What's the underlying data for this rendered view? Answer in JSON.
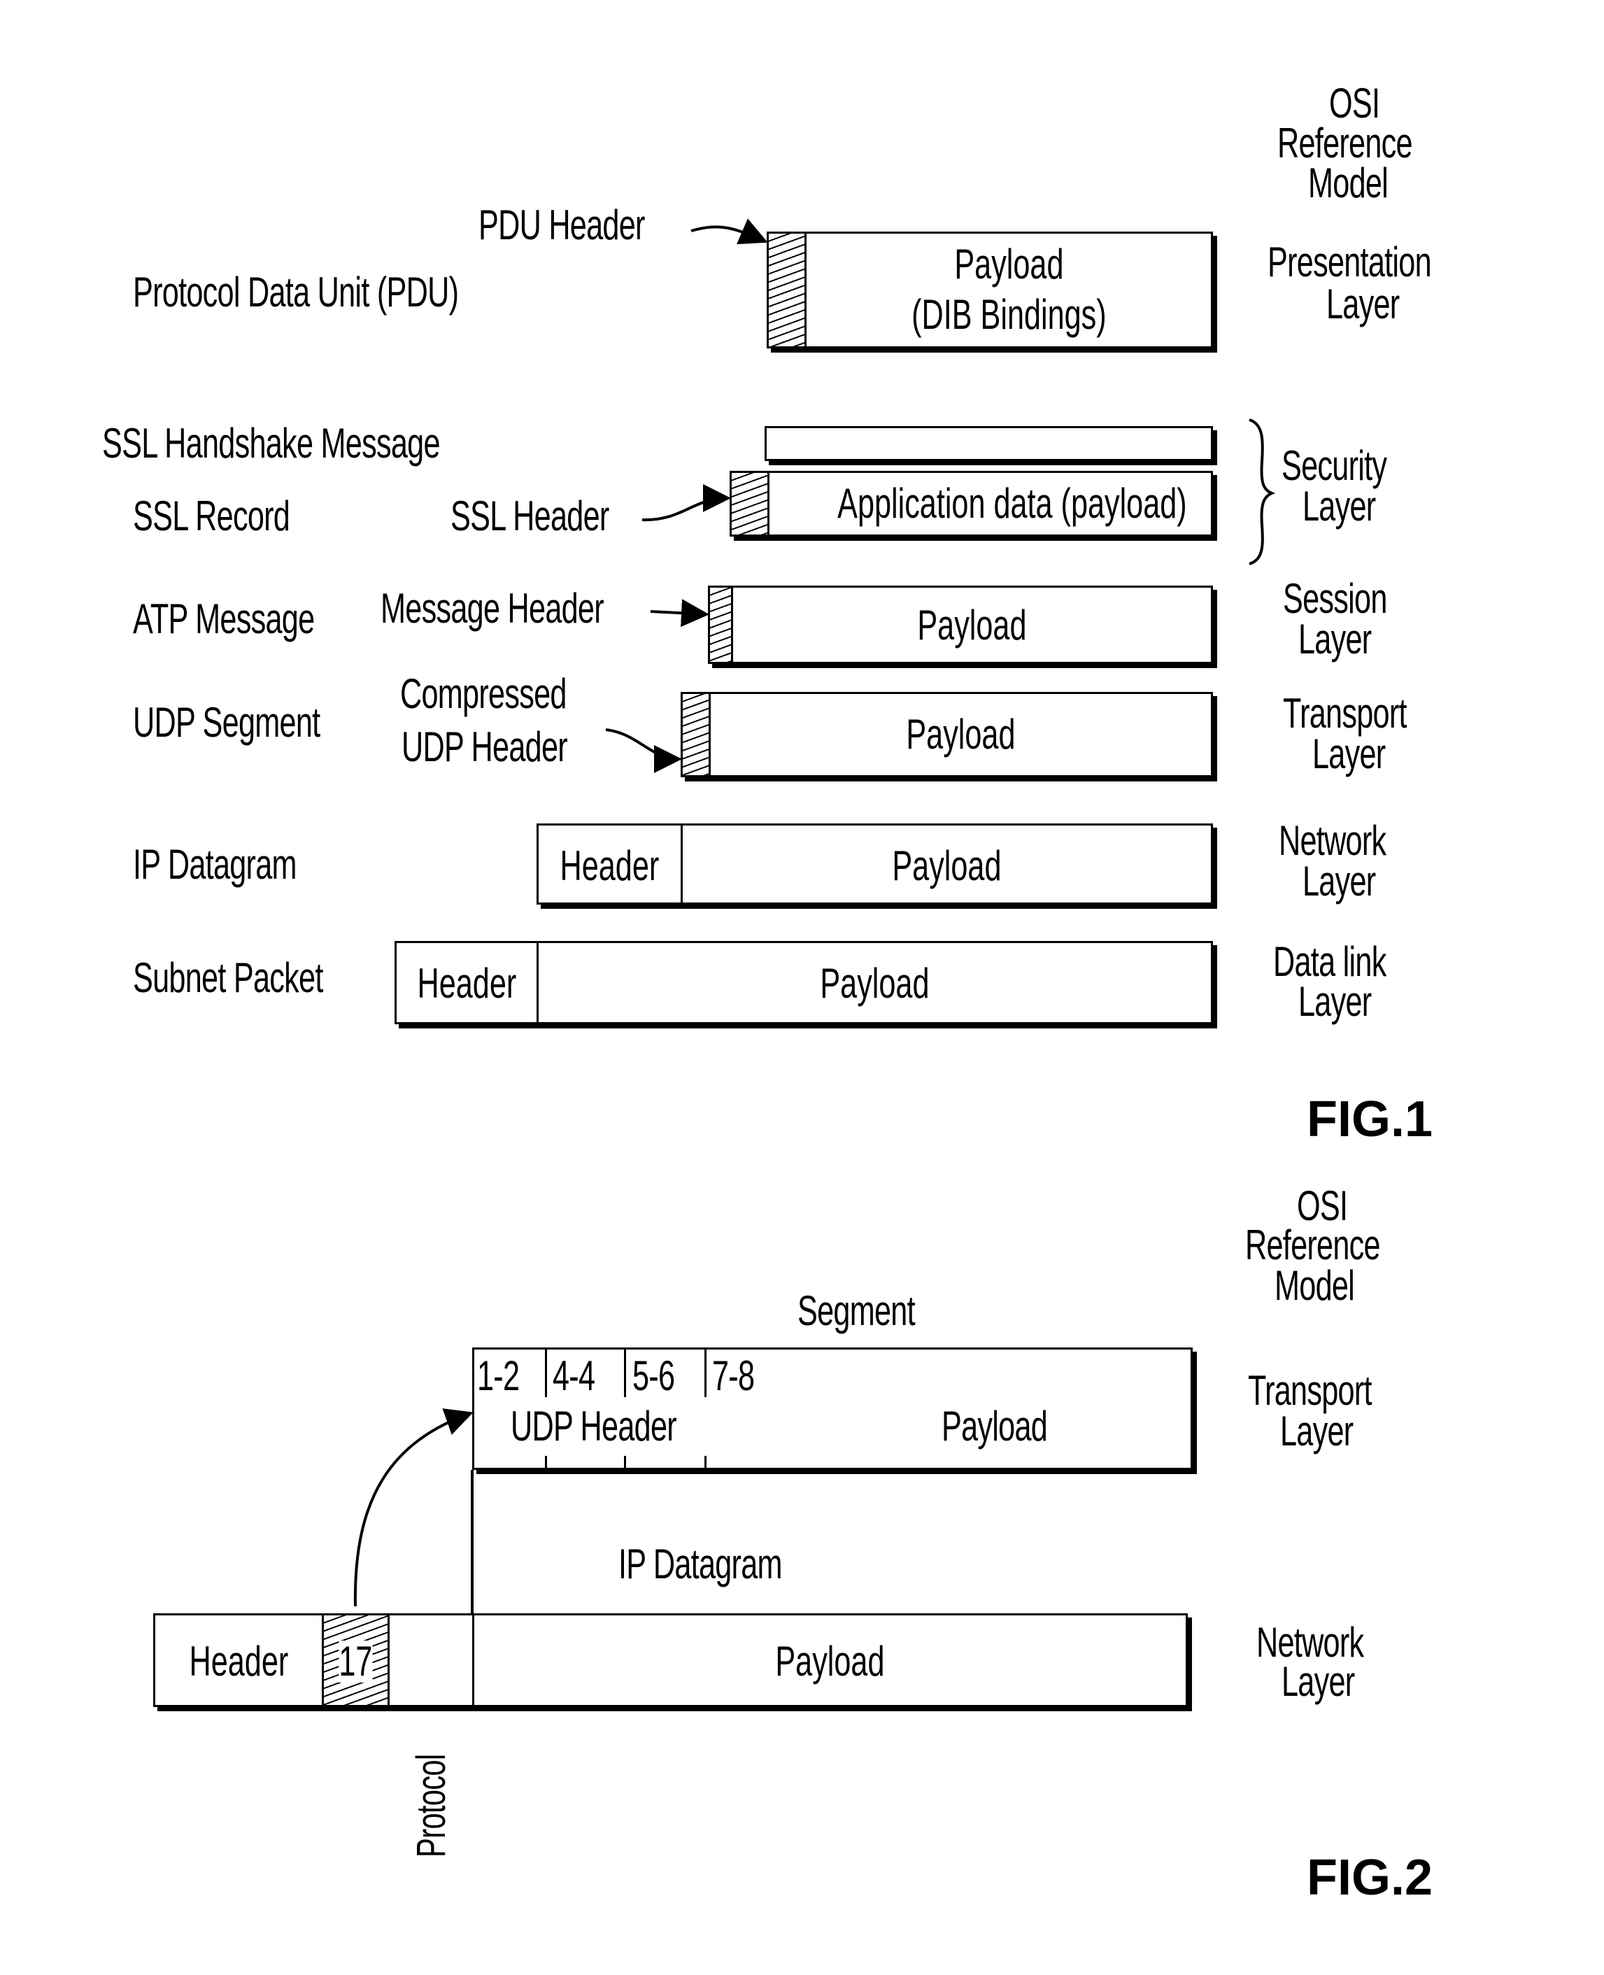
{
  "fig1": {
    "title": "FIG.1",
    "osi_header": [
      "OSI",
      "Reference",
      "Model"
    ],
    "rows": [
      {
        "id": "pdu",
        "name": "Protocol Data Unit (PDU)",
        "header_callout": "PDU Header",
        "payload": [
          "Payload",
          "(DIB Bindings)"
        ],
        "layer": [
          "Presentation",
          "Layer"
        ]
      },
      {
        "id": "ssl-handshake",
        "name": "SSL Handshake Message"
      },
      {
        "id": "ssl-record",
        "name": "SSL Record",
        "header_callout": "SSL Header",
        "payload": [
          "Application data (payload)"
        ],
        "layer": [
          "Security",
          "Layer"
        ]
      },
      {
        "id": "atp",
        "name": "ATP Message",
        "header_callout": "Message Header",
        "payload": [
          "Payload"
        ],
        "layer": [
          "Session",
          "Layer"
        ]
      },
      {
        "id": "udp",
        "name": "UDP Segment",
        "header_callout": [
          "Compressed",
          "UDP Header"
        ],
        "payload": [
          "Payload"
        ],
        "layer": [
          "Transport",
          "Layer"
        ]
      },
      {
        "id": "ip",
        "name": "IP Datagram",
        "header": "Header",
        "payload": [
          "Payload"
        ],
        "layer": [
          "Network",
          "Layer"
        ]
      },
      {
        "id": "subnet",
        "name": "Subnet Packet",
        "header": "Header",
        "payload": [
          "Payload"
        ],
        "layer": [
          "Data link",
          "Layer"
        ]
      }
    ]
  },
  "fig2": {
    "title": "FIG.2",
    "osi_header": [
      "OSI",
      "Reference",
      "Model"
    ],
    "segment": {
      "label": "Segment",
      "fields": [
        "1-2",
        "4-4",
        "5-6",
        "7-8"
      ],
      "header_label": "UDP Header",
      "payload": "Payload",
      "layer": [
        "Transport",
        "Layer"
      ]
    },
    "ip_datagram": {
      "label": "IP Datagram",
      "header": "Header",
      "protocol_value": "17",
      "protocol_label": "Protocol",
      "payload": "Payload",
      "layer": [
        "Network",
        "Layer"
      ]
    }
  }
}
